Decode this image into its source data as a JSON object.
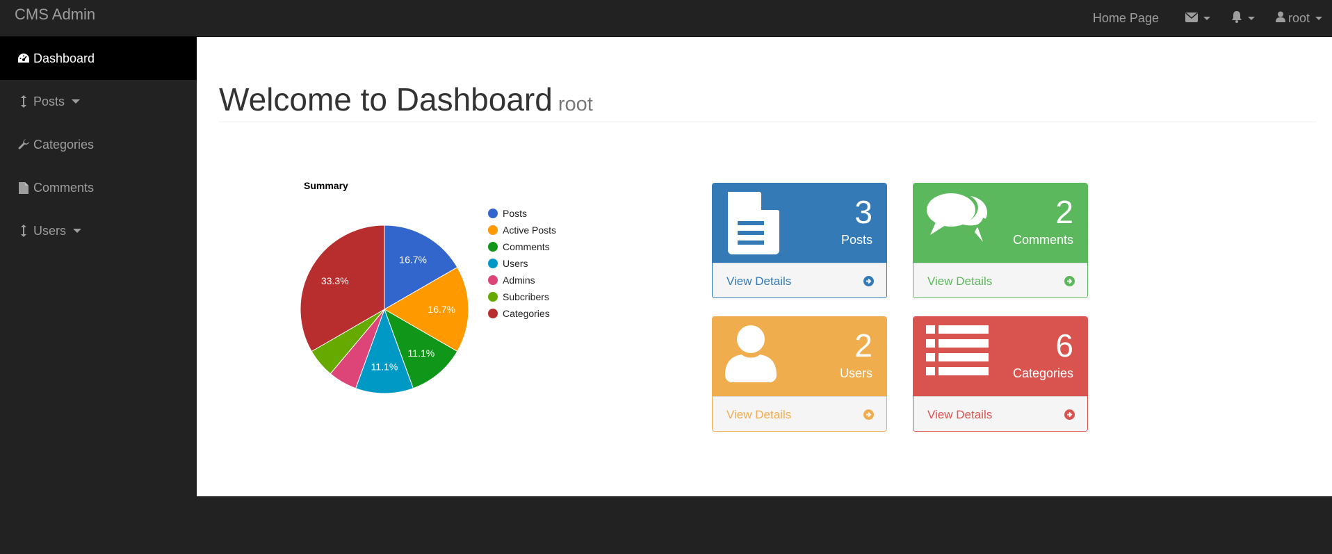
{
  "navbar": {
    "brand": "CMS Admin",
    "home_link": "Home Page",
    "user": "root"
  },
  "sidebar": {
    "items": [
      {
        "label": "Dashboard",
        "icon": "dashboard-icon",
        "active": true
      },
      {
        "label": "Posts",
        "icon": "arrows-v-icon",
        "dropdown": true
      },
      {
        "label": "Categories",
        "icon": "wrench-icon"
      },
      {
        "label": "Comments",
        "icon": "file-icon"
      },
      {
        "label": "Users",
        "icon": "arrows-v-icon",
        "dropdown": true
      }
    ]
  },
  "page": {
    "title": "Welcome to Dashboard",
    "subtitle": "root"
  },
  "chart_data": {
    "type": "pie",
    "title": "Summary",
    "categories": [
      "Posts",
      "Active Posts",
      "Comments",
      "Users",
      "Admins",
      "Subcribers",
      "Categories"
    ],
    "values": [
      3,
      3,
      2,
      2,
      1,
      1,
      6
    ],
    "slice_labels": [
      "16.7%",
      "16.7%",
      "11.1%",
      "11.1%",
      "",
      "",
      "33.3%"
    ],
    "colors": [
      "#3366cc",
      "#ff9900",
      "#109618",
      "#0099c6",
      "#dd4477",
      "#66aa00",
      "#b82e2e"
    ],
    "legend": "right"
  },
  "panels": [
    {
      "count": "3",
      "label": "Posts",
      "link": "View Details",
      "color": "#337ab7",
      "icon": "file-text-icon"
    },
    {
      "count": "2",
      "label": "Comments",
      "link": "View Details",
      "color": "#5cb85c",
      "icon": "comments-icon"
    },
    {
      "count": "2",
      "label": "Users",
      "link": "View Details",
      "color": "#f0ad4e",
      "icon": "user-icon"
    },
    {
      "count": "6",
      "label": "Categories",
      "link": "View Details",
      "color": "#d9534f",
      "icon": "list-icon"
    }
  ]
}
